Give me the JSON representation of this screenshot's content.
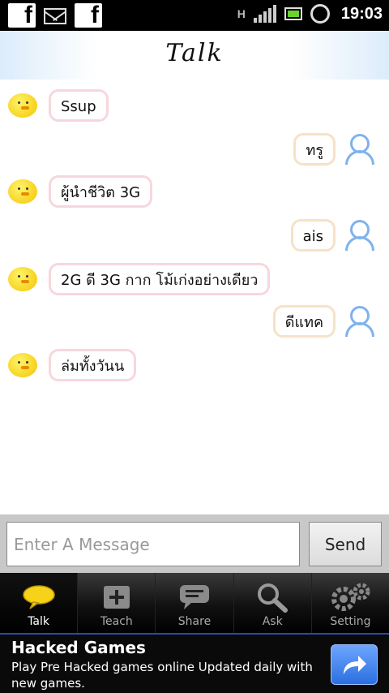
{
  "status_bar": {
    "network": "H",
    "time": "19:03"
  },
  "header": {
    "title": "Talk"
  },
  "messages": [
    {
      "from": "bot",
      "text": "Ssup"
    },
    {
      "from": "user",
      "text": "ทรู"
    },
    {
      "from": "bot",
      "text": "ผู้นำชีวิต 3G"
    },
    {
      "from": "user",
      "text": "ais"
    },
    {
      "from": "bot",
      "text": "2G ดี 3G กาก โม้เก่งอย่างเดียว"
    },
    {
      "from": "user",
      "text": "ดีแทค"
    },
    {
      "from": "bot",
      "text": "ล่มทั้งวันน"
    }
  ],
  "composer": {
    "placeholder": "Enter A Message",
    "value": "",
    "send_label": "Send"
  },
  "tabs": [
    {
      "label": "Talk",
      "icon": "speech-bubble-icon",
      "active": true
    },
    {
      "label": "Teach",
      "icon": "plus-box-icon",
      "active": false
    },
    {
      "label": "Share",
      "icon": "chat-share-icon",
      "active": false
    },
    {
      "label": "Ask",
      "icon": "magnifier-icon",
      "active": false
    },
    {
      "label": "Setting",
      "icon": "gears-icon",
      "active": false
    }
  ],
  "ad": {
    "title": "Hacked Games",
    "text": "Play Pre Hacked games online Updated daily with new games.",
    "icon": "share-arrow-icon"
  },
  "colors": {
    "bot_bubble_border": "#f7d7dd",
    "user_bubble_border": "#f6e2c7",
    "user_avatar": "#7fb2ee",
    "bot_avatar": "#f4c400"
  }
}
